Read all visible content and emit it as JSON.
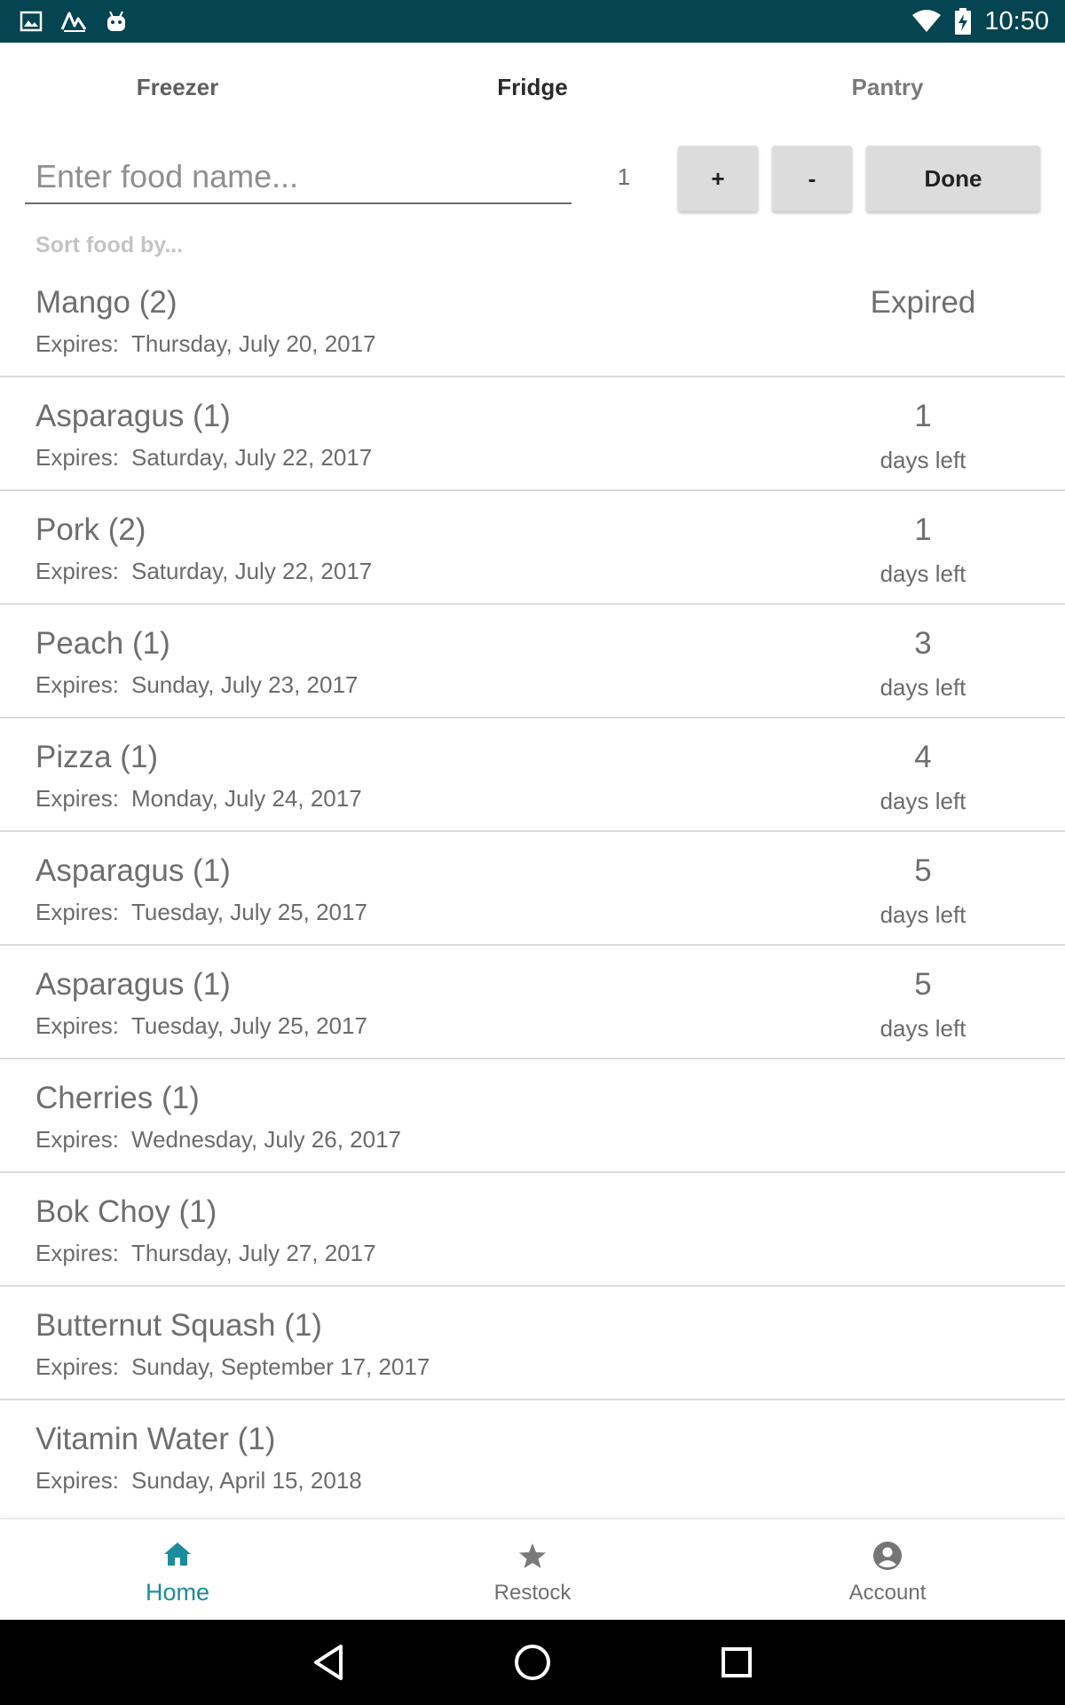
{
  "status_bar": {
    "time": "10:50",
    "left_icons": [
      "image-icon",
      "activity-icon",
      "android-icon"
    ],
    "right_icons": [
      "wifi-icon",
      "battery-charging-icon"
    ],
    "background": "#054451"
  },
  "tabs": [
    {
      "label": "Freezer"
    },
    {
      "label": "Fridge"
    },
    {
      "label": "Pantry"
    }
  ],
  "entry": {
    "placeholder": "Enter food name...",
    "quantity": "1",
    "plus_label": "+",
    "minus_label": "-",
    "done_label": "Done"
  },
  "sort_label": "Sort food by...",
  "items": [
    {
      "name": "Mango (2)",
      "expires_label": "Expires:",
      "expires": "Thursday, July 20, 2017",
      "status": "Expired",
      "status_sub": ""
    },
    {
      "name": "Asparagus (1)",
      "expires_label": "Expires:",
      "expires": "Saturday, July 22, 2017",
      "status": "1",
      "status_sub": "days left"
    },
    {
      "name": "Pork (2)",
      "expires_label": "Expires:",
      "expires": "Saturday, July 22, 2017",
      "status": "1",
      "status_sub": "days left"
    },
    {
      "name": "Peach (1)",
      "expires_label": "Expires:",
      "expires": "Sunday, July 23, 2017",
      "status": "3",
      "status_sub": "days left"
    },
    {
      "name": "Pizza (1)",
      "expires_label": "Expires:",
      "expires": "Monday, July 24, 2017",
      "status": "4",
      "status_sub": "days left"
    },
    {
      "name": "Asparagus (1)",
      "expires_label": "Expires:",
      "expires": "Tuesday, July 25, 2017",
      "status": "5",
      "status_sub": "days left"
    },
    {
      "name": "Asparagus (1)",
      "expires_label": "Expires:",
      "expires": "Tuesday, July 25, 2017",
      "status": "5",
      "status_sub": "days left"
    },
    {
      "name": "Cherries (1)",
      "expires_label": "Expires:",
      "expires": "Wednesday, July 26, 2017",
      "status": "",
      "status_sub": ""
    },
    {
      "name": "Bok Choy (1)",
      "expires_label": "Expires:",
      "expires": "Thursday, July 27, 2017",
      "status": "",
      "status_sub": ""
    },
    {
      "name": "Butternut Squash (1)",
      "expires_label": "Expires:",
      "expires": "Sunday, September 17, 2017",
      "status": "",
      "status_sub": ""
    },
    {
      "name": "Vitamin Water (1)",
      "expires_label": "Expires:",
      "expires": "Sunday, April 15, 2018",
      "status": "",
      "status_sub": ""
    }
  ],
  "bottom_nav": [
    {
      "label": "Home",
      "icon": "home-icon",
      "active": true
    },
    {
      "label": "Restock",
      "icon": "star-icon",
      "active": false
    },
    {
      "label": "Account",
      "icon": "account-icon",
      "active": false
    }
  ],
  "system_nav": [
    "back-icon",
    "home-circle-icon",
    "recents-icon"
  ],
  "colors": {
    "accent": "#1a8c9c",
    "status_bar": "#054451",
    "button": "#dcdcdc"
  }
}
